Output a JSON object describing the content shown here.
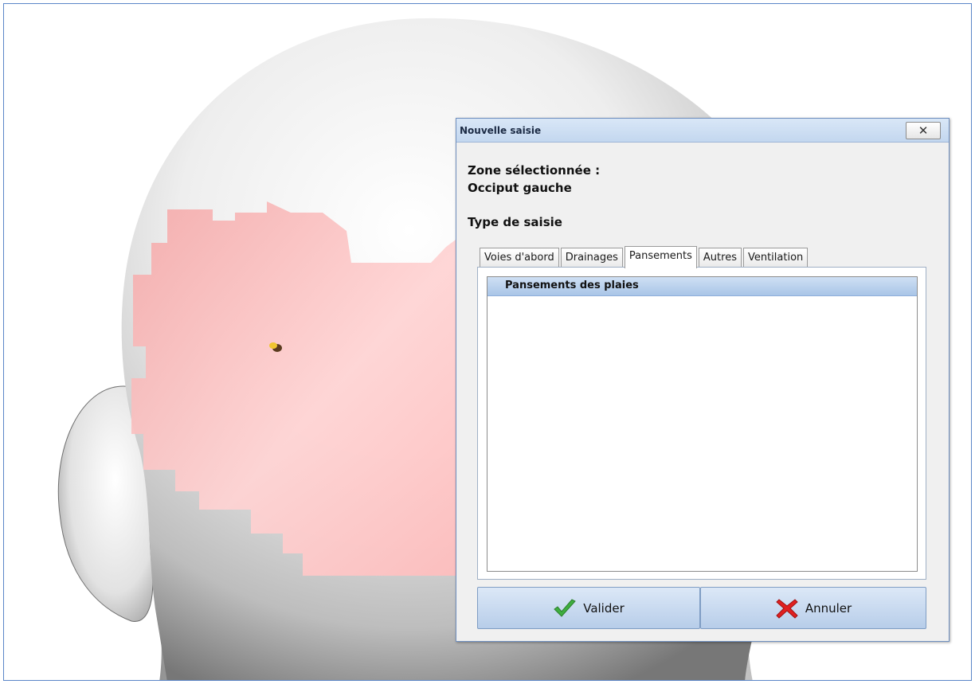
{
  "dialog": {
    "title": "Nouvelle saisie",
    "close_label": "✕",
    "zone_label": "Zone sélectionnée :",
    "zone_value": "Occiput gauche",
    "type_label": "Type de saisie",
    "tabs": [
      {
        "label": "Voies d'abord",
        "active": false
      },
      {
        "label": "Drainages",
        "active": false
      },
      {
        "label": "Pansements",
        "active": true
      },
      {
        "label": "Autres",
        "active": false
      },
      {
        "label": "Ventilation",
        "active": false
      }
    ],
    "list_items": [
      "Pansements des plaies"
    ],
    "ok_label": "Valider",
    "cancel_label": "Annuler"
  },
  "viewport": {
    "icons": {
      "ok": "check-icon",
      "cancel": "x-icon"
    },
    "colors": {
      "highlight": "#ffb8b8",
      "marker": "#e8c12a",
      "accent": "#5b86c8"
    }
  }
}
